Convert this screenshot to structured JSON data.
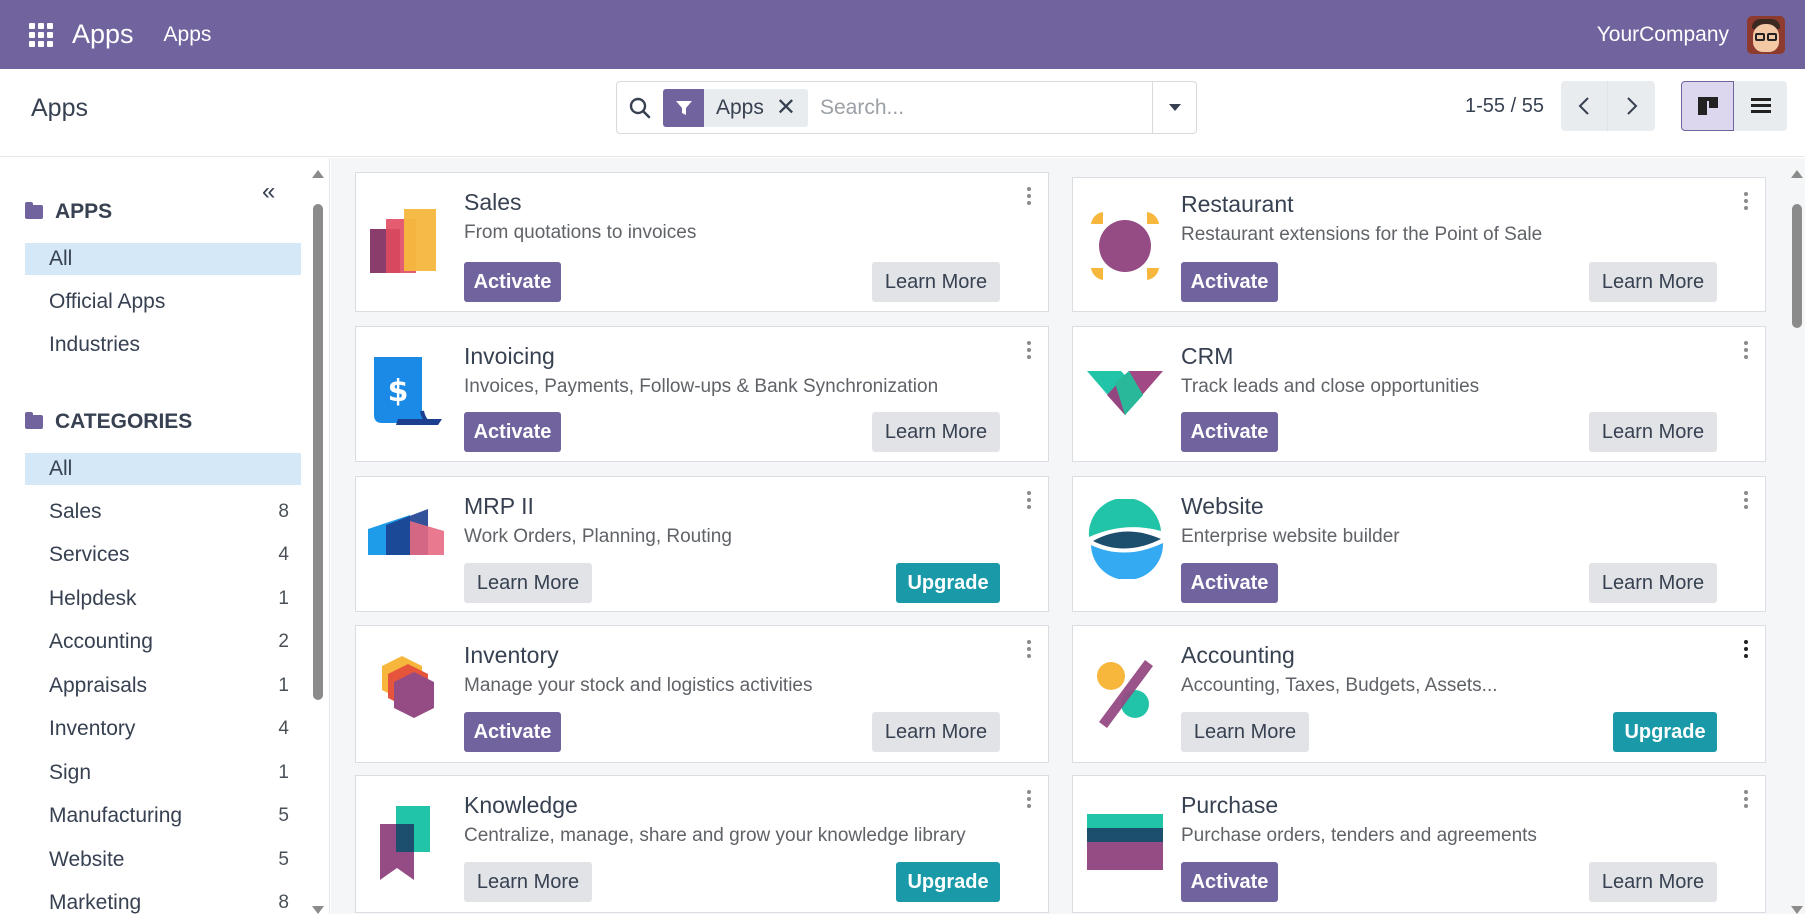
{
  "navbar": {
    "title": "Apps",
    "menu_apps": "Apps",
    "company": "YourCompany"
  },
  "control": {
    "breadcrumb": "Apps",
    "facet_label": "Apps",
    "facet_remove": "✕",
    "search_placeholder": "Search...",
    "pager": "1-55 / 55"
  },
  "sidebar": {
    "apps_heading": "APPS",
    "apps_items": [
      {
        "label": "All"
      },
      {
        "label": "Official Apps"
      },
      {
        "label": "Industries"
      }
    ],
    "categories_heading": "CATEGORIES",
    "categories": [
      {
        "label": "All",
        "count": ""
      },
      {
        "label": "Sales",
        "count": "8"
      },
      {
        "label": "Services",
        "count": "4"
      },
      {
        "label": "Helpdesk",
        "count": "1"
      },
      {
        "label": "Accounting",
        "count": "2"
      },
      {
        "label": "Appraisals",
        "count": "1"
      },
      {
        "label": "Inventory",
        "count": "4"
      },
      {
        "label": "Sign",
        "count": "1"
      },
      {
        "label": "Manufacturing",
        "count": "5"
      },
      {
        "label": "Website",
        "count": "5"
      },
      {
        "label": "Marketing",
        "count": "8"
      }
    ]
  },
  "buttons": {
    "activate": "Activate",
    "learn_more": "Learn More",
    "upgrade": "Upgrade"
  },
  "apps": [
    {
      "title": "Sales",
      "subtitle": "From quotations to invoices",
      "icon": "sales-icon"
    },
    {
      "title": "Restaurant",
      "subtitle": "Restaurant extensions for the Point of Sale",
      "icon": "restaurant-icon"
    },
    {
      "title": "Invoicing",
      "subtitle": "Invoices, Payments, Follow-ups & Bank Synchronization",
      "icon": "invoicing-icon"
    },
    {
      "title": "CRM",
      "subtitle": "Track leads and close opportunities",
      "icon": "crm-icon"
    },
    {
      "title": "MRP II",
      "subtitle": "Work Orders, Planning, Routing",
      "icon": "mrp-icon"
    },
    {
      "title": "Website",
      "subtitle": "Enterprise website builder",
      "icon": "website-icon"
    },
    {
      "title": "Inventory",
      "subtitle": "Manage your stock and logistics activities",
      "icon": "inventory-icon"
    },
    {
      "title": "Accounting",
      "subtitle": "Accounting, Taxes, Budgets, Assets...",
      "icon": "accounting-icon"
    },
    {
      "title": "Knowledge",
      "subtitle": "Centralize, manage, share and grow your knowledge library",
      "icon": "knowledge-icon"
    },
    {
      "title": "Purchase",
      "subtitle": "Purchase orders, tenders and agreements",
      "icon": "purchase-icon"
    }
  ],
  "colors": {
    "brand": "#71639e",
    "upgrade": "#1a9aa8",
    "active_filter": "#d5e8f8"
  }
}
